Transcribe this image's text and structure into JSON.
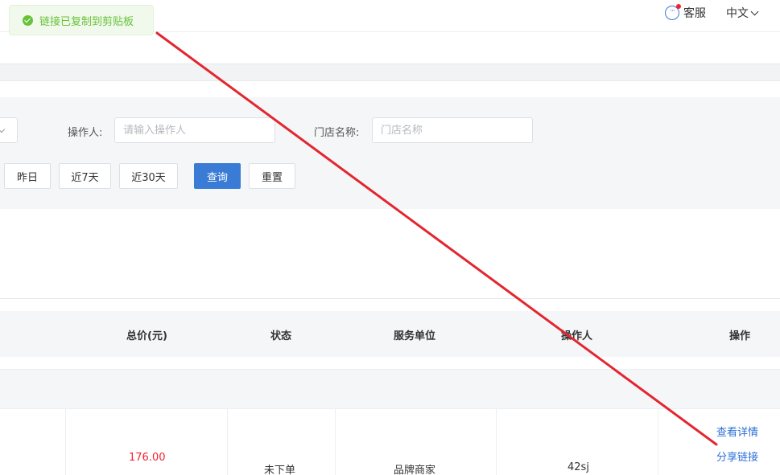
{
  "toast": {
    "message": "链接已复制到剪贴板",
    "type": "success"
  },
  "header": {
    "service_label": "客服",
    "language_label": "中文"
  },
  "filters": {
    "operator_label": "操作人:",
    "operator_placeholder": "请输入操作人",
    "store_label": "门店名称:",
    "store_placeholder": "门店名称",
    "date_buttons": [
      "昨日",
      "近7天",
      "近30天"
    ],
    "query_label": "查询",
    "reset_label": "重置"
  },
  "table": {
    "columns": [
      "总价(元)",
      "状态",
      "服务单位",
      "操作人",
      "操作"
    ],
    "rows": [
      {
        "total_price": "176.00",
        "status": "未下单",
        "service_unit": "品牌商家",
        "operator": "42sj",
        "actions": [
          "查看详情",
          "分享链接"
        ]
      }
    ]
  },
  "colors": {
    "primary": "#3a7bd5",
    "success": "#67c23a",
    "price": "#f5222d",
    "annotation": "#e32630"
  }
}
